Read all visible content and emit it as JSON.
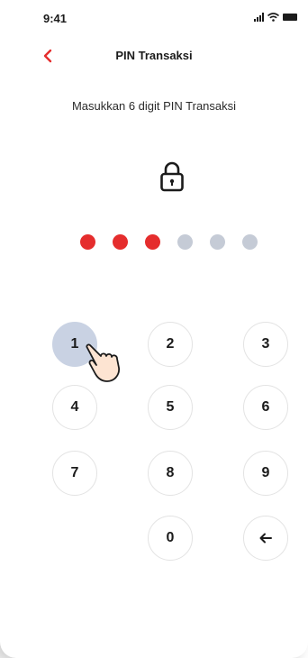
{
  "status": {
    "time": "9:41"
  },
  "header": {
    "title": "PIN Transaksi",
    "back_icon": "chevron-left-icon"
  },
  "prompt": "Masukkan 6 digit PIN Transaksi",
  "pin": {
    "length": 6,
    "entered": 3,
    "filled_color": "#e52d2d",
    "empty_color": "#c5cbd6"
  },
  "keypad": {
    "keys": [
      "1",
      "2",
      "3",
      "4",
      "5",
      "6",
      "7",
      "8",
      "9",
      "0"
    ],
    "backspace_icon": "arrow-left-icon",
    "pressed_key": "1"
  },
  "colors": {
    "accent": "#e52d2d"
  }
}
